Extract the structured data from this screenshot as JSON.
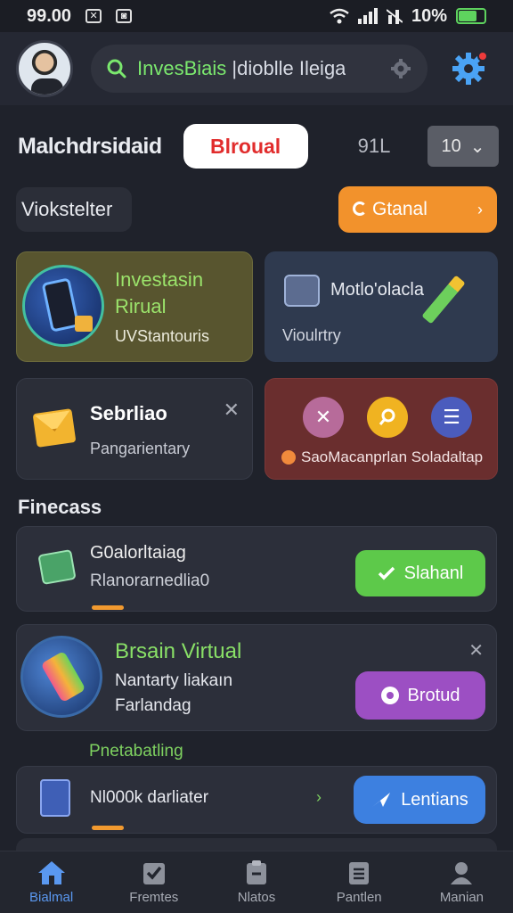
{
  "status_bar": {
    "time": "99.00",
    "signal_percent": "10%"
  },
  "header": {
    "search_text_accent": "InvesBiais",
    "search_text_rest": " |dioblle Ileiga"
  },
  "title_row": {
    "title": "Malchdrsidaid",
    "pill_label": "Blroual",
    "count": "91L",
    "select_value": "10"
  },
  "row_two": {
    "chip_label": "Viokstelter",
    "orange_button_label": "Gtanal"
  },
  "cards": {
    "a": {
      "title_line1": "Investasin",
      "title_line2": "Rirual",
      "subtitle": "UVStantouris"
    },
    "b": {
      "title": "Motlo'olacla",
      "subtitle": "Vioulrtry"
    },
    "c": {
      "title": "Sebrliao",
      "subtitle": "Pangarientary"
    },
    "d": {
      "caption": "SaoMacanprlan Soladaltap"
    }
  },
  "section": {
    "title": "Finecass"
  },
  "list": [
    {
      "title": "G0alorltaiag",
      "subtitle": "Rlanorarnedlia0",
      "button": "Slahanl"
    },
    {
      "title": "Brsain Virtual",
      "line2": "Nantarty liakaın",
      "line3": "Farlandag",
      "button": "Brotud"
    },
    {
      "title": "Nl000k darliater",
      "button": "Lentians"
    }
  ],
  "subsection": {
    "title": "Pnetabatling"
  },
  "bottom_nav": [
    {
      "label": "Bialmal",
      "icon": "home-icon",
      "active": true
    },
    {
      "label": "Fremtes",
      "icon": "checklist-icon",
      "active": false
    },
    {
      "label": "Nlatos",
      "icon": "task-icon",
      "active": false
    },
    {
      "label": "Pantlen",
      "icon": "document-icon",
      "active": false
    },
    {
      "label": "Manian",
      "icon": "person-icon",
      "active": false
    }
  ],
  "colors": {
    "accent_green": "#7be86e",
    "orange": "#f2922c",
    "green_button": "#5dc94a",
    "purple_button": "#9c4fc3",
    "blue_button": "#3d80e0",
    "active_nav": "#5a98f0"
  }
}
